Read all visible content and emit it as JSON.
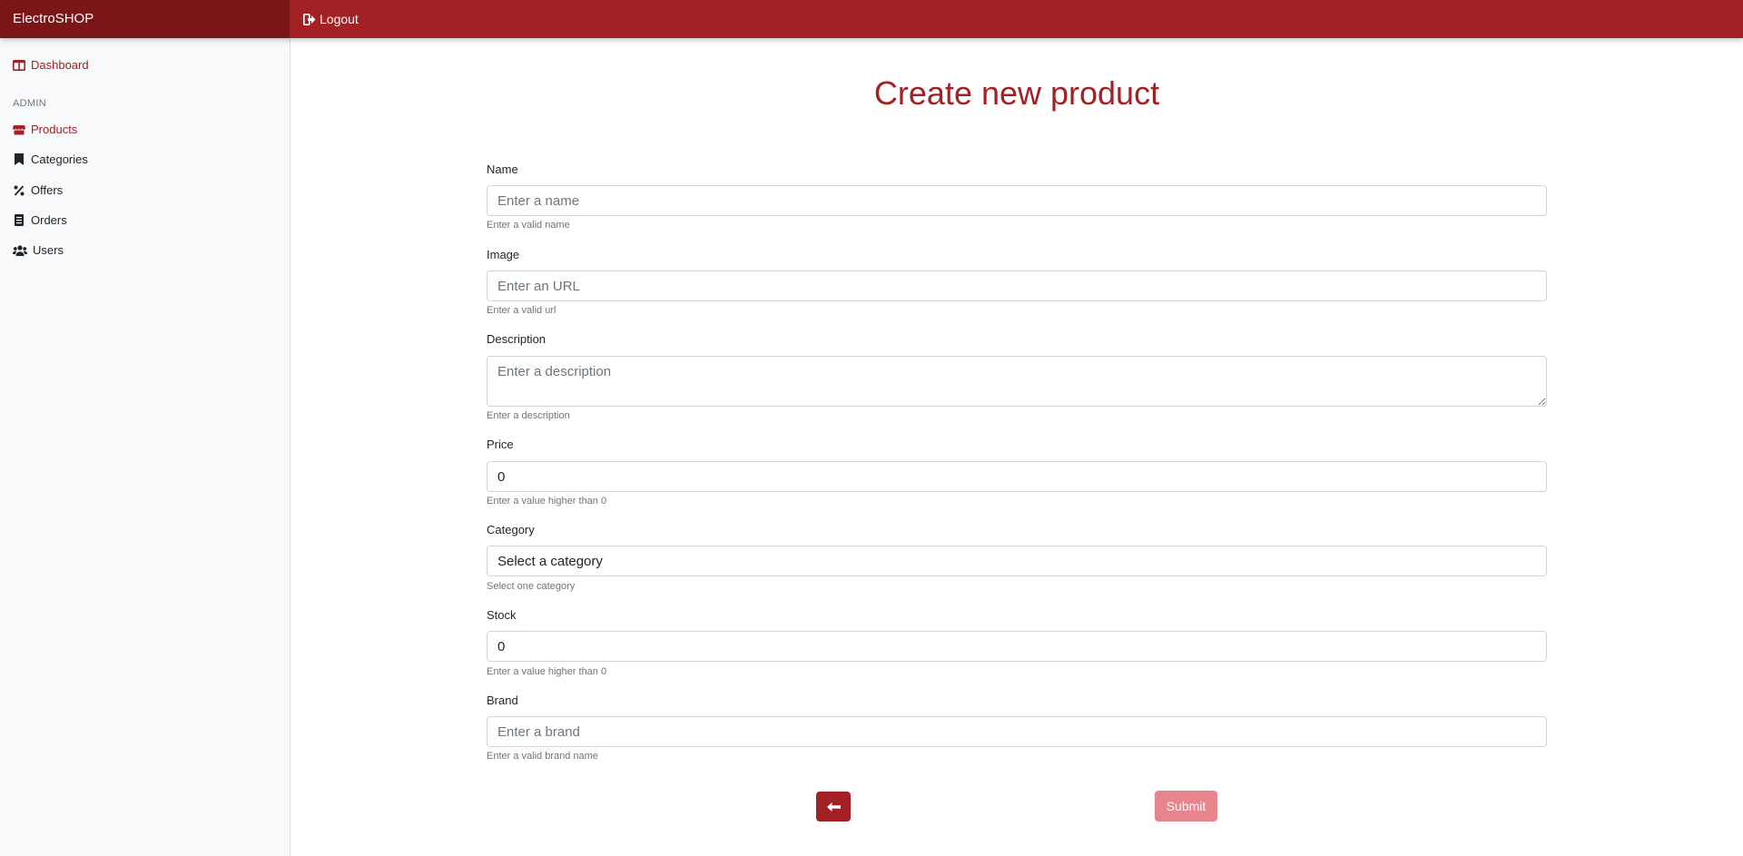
{
  "header": {
    "brand": "ElectroSHOP",
    "logout_label": "Logout"
  },
  "sidebar": {
    "dashboard": "Dashboard",
    "section_heading": "ADMIN",
    "items": [
      {
        "label": "Products",
        "icon": "store-icon",
        "active": true
      },
      {
        "label": "Categories",
        "icon": "bookmark-icon"
      },
      {
        "label": "Offers",
        "icon": "percent-icon"
      },
      {
        "label": "Orders",
        "icon": "receipt-icon"
      },
      {
        "label": "Users",
        "icon": "users-icon"
      }
    ]
  },
  "form": {
    "title": "Create new product",
    "name": {
      "label": "Name",
      "placeholder": "Enter a name",
      "helper": "Enter a valid name"
    },
    "image": {
      "label": "Image",
      "placeholder": "Enter an URL",
      "helper": "Enter a valid url"
    },
    "description": {
      "label": "Description",
      "placeholder": "Enter a description",
      "helper": "Enter a description"
    },
    "price": {
      "label": "Price",
      "value": "0",
      "helper": "Enter a value higher than 0"
    },
    "category": {
      "label": "Category",
      "value": "Select a category",
      "helper": "Select one category"
    },
    "stock": {
      "label": "Stock",
      "value": "0",
      "helper": "Enter a value higher than 0"
    },
    "brand": {
      "label": "Brand",
      "placeholder": "Enter a brand",
      "helper": "Enter a valid brand name"
    },
    "submit_label": "Submit"
  },
  "colors": {
    "primary": "#a12125",
    "brand_bg": "#7b1618",
    "submit_disabled": "#e8848b"
  }
}
